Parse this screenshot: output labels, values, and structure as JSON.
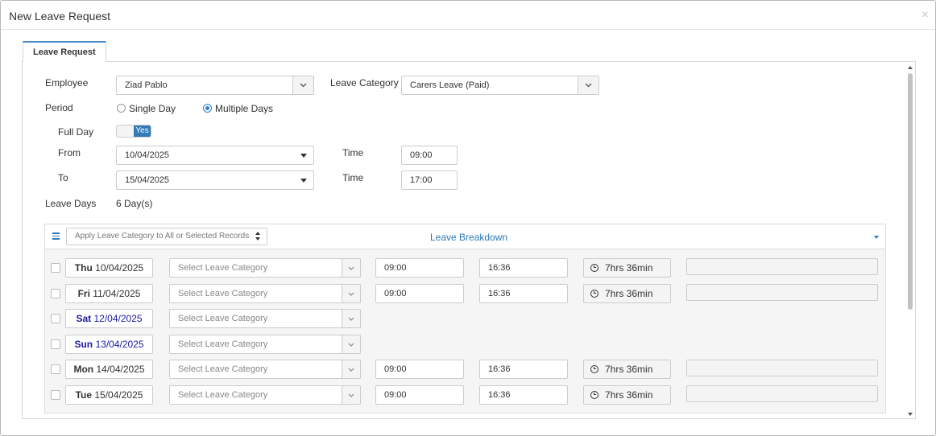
{
  "modal": {
    "title": "New Leave Request",
    "close_glyph": "×"
  },
  "tabs": [
    {
      "label": "Leave Request"
    }
  ],
  "form": {
    "employee": {
      "label": "Employee",
      "value": "Ziad Pablo"
    },
    "leave_category": {
      "label": "Leave Category",
      "value": "Carers Leave (Paid)"
    },
    "period": {
      "label": "Period",
      "options": [
        {
          "label": "Single Day",
          "selected": false
        },
        {
          "label": "Multiple Days",
          "selected": true
        }
      ]
    },
    "full_day": {
      "label": "Full Day",
      "value": "Yes"
    },
    "from": {
      "label": "From",
      "date": "10/04/2025",
      "time_label": "Time",
      "time": "09:00"
    },
    "to": {
      "label": "To",
      "date": "15/04/2025",
      "time_label": "Time",
      "time": "17:00"
    },
    "leave_days": {
      "label": "Leave Days",
      "value": "6 Day(s)"
    }
  },
  "breakdown": {
    "title": "Leave Breakdown",
    "apply_placeholder": "Apply Leave Category to All or Selected Records",
    "category_placeholder": "Select Leave Category",
    "rows": [
      {
        "day": "Thu",
        "date": "10/04/2025",
        "weekend": false,
        "start": "09:00",
        "end": "16:36",
        "duration": "7hrs 36min"
      },
      {
        "day": "Fri",
        "date": "11/04/2025",
        "weekend": false,
        "start": "09:00",
        "end": "16:36",
        "duration": "7hrs 36min"
      },
      {
        "day": "Sat",
        "date": "12/04/2025",
        "weekend": true
      },
      {
        "day": "Sun",
        "date": "13/04/2025",
        "weekend": true
      },
      {
        "day": "Mon",
        "date": "14/04/2025",
        "weekend": false,
        "start": "09:00",
        "end": "16:36",
        "duration": "7hrs 36min"
      },
      {
        "day": "Tue",
        "date": "15/04/2025",
        "weekend": false,
        "start": "09:00",
        "end": "16:36",
        "duration": "7hrs 36min"
      }
    ]
  },
  "colors": {
    "accent": "#337ab7",
    "weekend_text": "#1a1aa6",
    "link": "#2a7ab8"
  }
}
